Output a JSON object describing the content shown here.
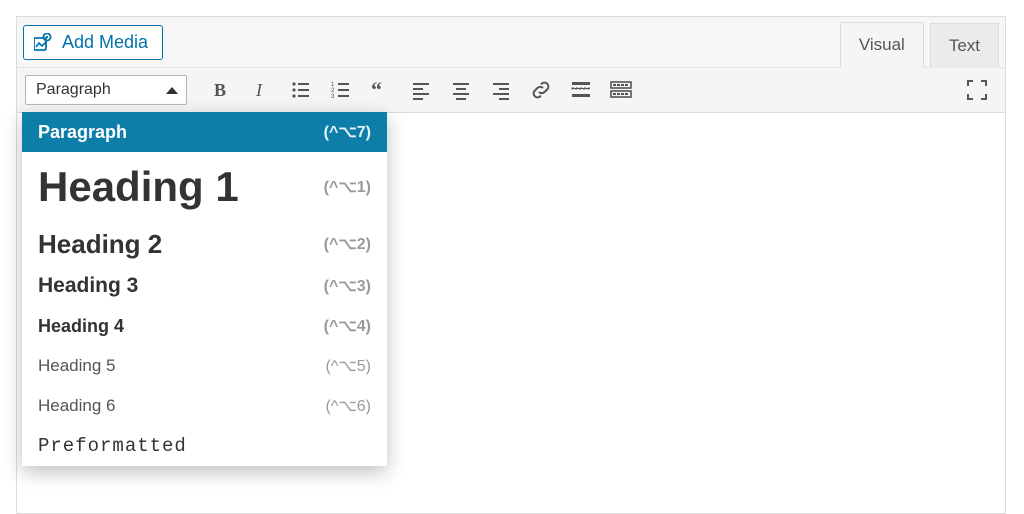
{
  "addMedia": {
    "label": "Add Media"
  },
  "tabs": {
    "visual": "Visual",
    "text": "Text",
    "active": "visual"
  },
  "formatSelect": {
    "current": "Paragraph"
  },
  "dropdown": {
    "items": [
      {
        "label": "Paragraph",
        "shortcut": "(^⌥7)",
        "cls": "dd-paragraph",
        "selected": true
      },
      {
        "label": "Heading 1",
        "shortcut": "(^⌥1)",
        "cls": "dd-h1"
      },
      {
        "label": "Heading 2",
        "shortcut": "(^⌥2)",
        "cls": "dd-h2"
      },
      {
        "label": "Heading 3",
        "shortcut": "(^⌥3)",
        "cls": "dd-h3"
      },
      {
        "label": "Heading 4",
        "shortcut": "(^⌥4)",
        "cls": "dd-h4"
      },
      {
        "label": "Heading 5",
        "shortcut": "(^⌥5)",
        "cls": "dd-h5"
      },
      {
        "label": "Heading 6",
        "shortcut": "(^⌥6)",
        "cls": "dd-h6"
      },
      {
        "label": "Preformatted",
        "shortcut": "",
        "cls": "dd-pre"
      }
    ]
  },
  "toolbar": {
    "buttons": [
      {
        "name": "bold"
      },
      {
        "name": "italic"
      },
      {
        "name": "bullet-list"
      },
      {
        "name": "number-list"
      },
      {
        "name": "blockquote"
      },
      {
        "name": "align-left"
      },
      {
        "name": "align-center"
      },
      {
        "name": "align-right"
      },
      {
        "name": "link"
      },
      {
        "name": "read-more"
      },
      {
        "name": "toolbar-toggle"
      }
    ],
    "fullscreenName": "fullscreen"
  }
}
